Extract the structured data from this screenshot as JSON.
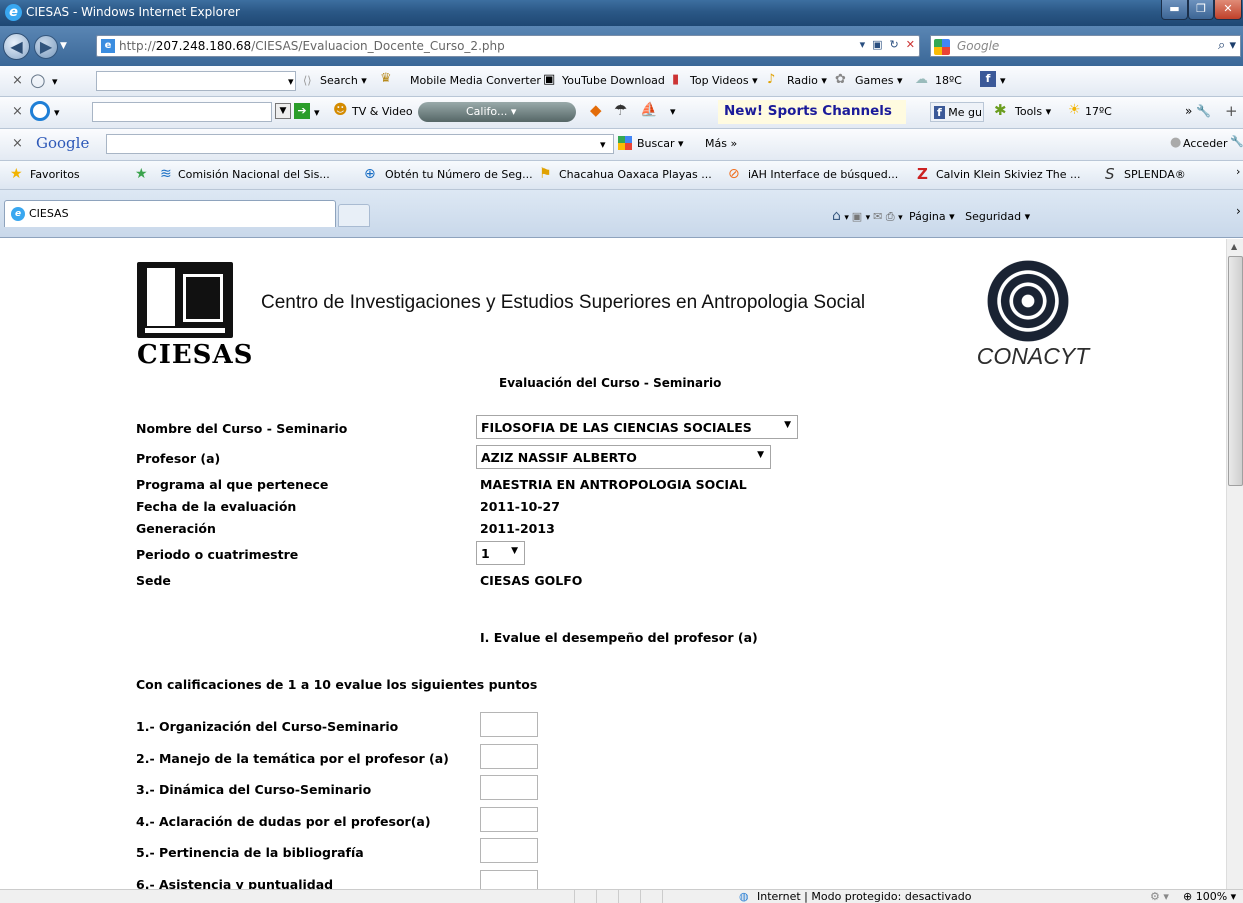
{
  "window": {
    "title": "CIESAS - Windows Internet Explorer"
  },
  "address": {
    "url_prefix": "http://",
    "url_host": "207.248.180.68",
    "url_path": "/CIESAS/Evaluacion_Docente_Curso_2.php",
    "search_placeholder": "Google"
  },
  "toolbar1": {
    "search": "Search",
    "mobile": "Mobile Media Converter",
    "youtube": "YouTube Download",
    "topvideos": "Top Videos",
    "radio": "Radio",
    "games": "Games",
    "temp": "18ºC"
  },
  "toolbar2": {
    "tv": "TV & Video",
    "radio_station": "Califo...",
    "sports": "New! Sports Channels",
    "fb": "Me gu",
    "tools": "Tools",
    "temp": "17ºC"
  },
  "toolbar3": {
    "google": "Google",
    "buscar": "Buscar",
    "mas": "Más",
    "acceder": "Acceder"
  },
  "favorites": {
    "label": "Favoritos",
    "items": [
      "Comisión Nacional del Sis...",
      "Obtén tu Número de Seg...",
      "Chacahua Oaxaca  Playas ...",
      "iAH Interface de búsqued...",
      "Calvin Klein  Skiviez  The ...",
      "SPLENDA®"
    ]
  },
  "tabs": {
    "active": "CIESAS",
    "page": "Página",
    "security": "Seguridad"
  },
  "page": {
    "org_name": "Centro de Investigaciones y Estudios Superiores en Antropologia Social",
    "logo_left": "CIESAS",
    "logo_right": "CONACYT",
    "eval_title": "Evaluación del Curso - Seminario",
    "fields": {
      "curso_label": "Nombre del Curso - Seminario",
      "curso_value": "FILOSOFIA DE LAS CIENCIAS SOCIALES",
      "profesor_label": "Profesor (a)",
      "profesor_value": "AZIZ NASSIF ALBERTO",
      "programa_label": "Programa al que pertenece",
      "programa_value": "MAESTRIA EN ANTROPOLOGIA SOCIAL",
      "fecha_label": "Fecha de la evaluación",
      "fecha_value": "2011-10-27",
      "generacion_label": "Generación",
      "generacion_value": "2011-2013",
      "periodo_label": "Periodo o cuatrimestre",
      "periodo_value": "1",
      "sede_label": "Sede",
      "sede_value": "CIESAS GOLFO"
    },
    "section_title": "I. Evalue el desempeño del profesor (a)",
    "instructions": "Con calificaciones de 1 a 10 evalue los siguientes puntos",
    "questions": [
      "1.- Organización del Curso-Seminario",
      "2.- Manejo de la temática por el profesor (a)",
      "3.- Dinámica del Curso-Seminario",
      "4.- Aclaración de dudas por el profesor(a)",
      "5.- Pertinencia de la bibliografía",
      "6.- Asistencia y puntualidad"
    ]
  },
  "status": {
    "zone": "Internet | Modo protegido: desactivado",
    "zoom": "100%"
  }
}
